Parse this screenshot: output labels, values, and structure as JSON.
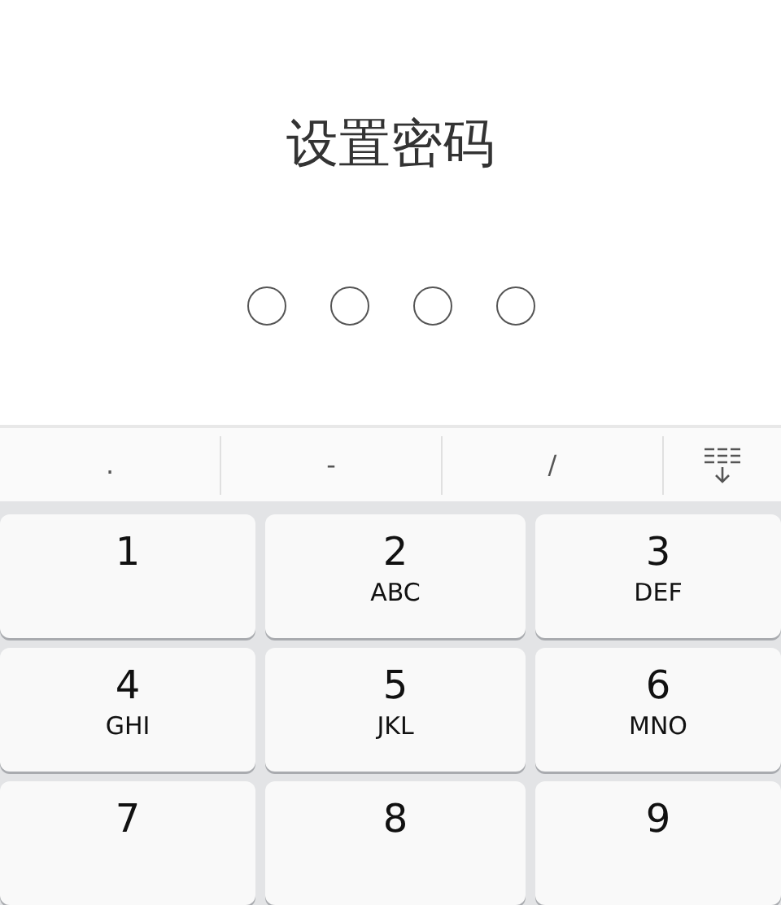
{
  "title": "设置密码",
  "pin_dots": [
    {
      "filled": false
    },
    {
      "filled": false
    },
    {
      "filled": false
    },
    {
      "filled": false
    }
  ],
  "symbol_bar": [
    ".",
    "-",
    "/"
  ],
  "keys": [
    {
      "digit": "1"
    },
    {
      "digit": "2",
      "letters": "ABC"
    },
    {
      "digit": "3",
      "letters": "DEF"
    },
    {
      "digit": "4",
      "letters": "GHI"
    },
    {
      "digit": "5",
      "letters": "JKL"
    },
    {
      "digit": "6",
      "letters": "MNO"
    },
    {
      "digit": "7"
    },
    {
      "digit": "8"
    },
    {
      "digit": "9"
    }
  ]
}
